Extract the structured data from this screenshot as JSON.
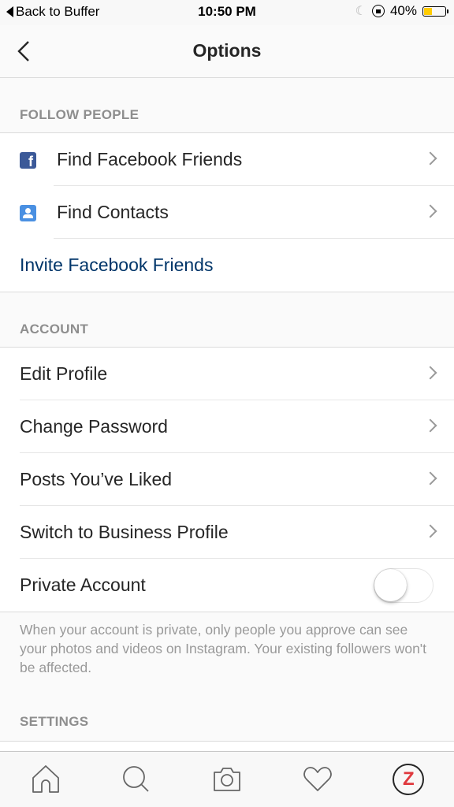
{
  "status_bar": {
    "back_app": "Back to Buffer",
    "time": "10:50 PM",
    "battery_percent": "40%",
    "battery_level": 0.4
  },
  "navbar": {
    "title": "Options"
  },
  "sections": {
    "follow_people": {
      "header": "FOLLOW PEOPLE",
      "items": [
        {
          "label": "Find Facebook Friends",
          "icon": "facebook-icon"
        },
        {
          "label": "Find Contacts",
          "icon": "contacts-icon"
        },
        {
          "label": "Invite Facebook Friends"
        }
      ]
    },
    "account": {
      "header": "ACCOUNT",
      "items": [
        {
          "label": "Edit Profile"
        },
        {
          "label": "Change Password"
        },
        {
          "label": "Posts You’ve Liked"
        },
        {
          "label": "Switch to Business Profile"
        },
        {
          "label": "Private Account",
          "toggle": false
        }
      ],
      "footnote": "When your account is private, only people you approve can see your photos and videos on Instagram. Your existing followers won't be affected."
    },
    "settings": {
      "header": "SETTINGS"
    }
  },
  "tabbar": {
    "tabs": [
      "home",
      "search",
      "camera",
      "activity",
      "profile"
    ],
    "avatar_letter": "Z"
  },
  "colors": {
    "link": "#003569",
    "facebook": "#3b5998",
    "contacts": "#4a90e2",
    "avatar_letter": "#e0393e",
    "battery": "#ffcc00"
  }
}
